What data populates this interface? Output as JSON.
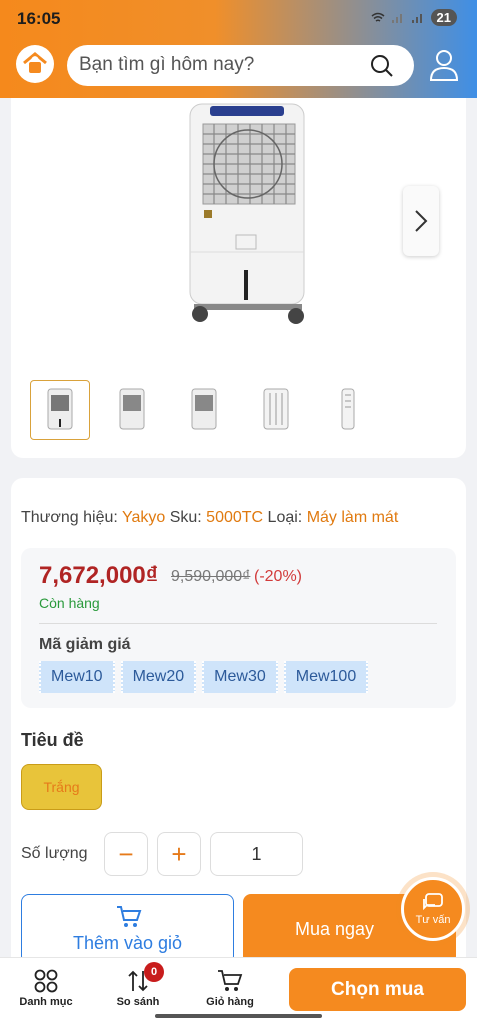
{
  "status": {
    "time": "16:05",
    "battery": "21"
  },
  "header": {
    "search_placeholder": "Bạn tìm gì hôm nay?",
    "icons": [
      "home-bag-logo",
      "search-icon",
      "user-icon"
    ]
  },
  "gallery": {
    "thumbnails": 5,
    "selected": 1,
    "next_icon": "chevron-right-icon"
  },
  "product": {
    "brand_label": "Thương hiệu:",
    "brand": "Yakyo",
    "sku_label": "Sku:",
    "sku": "5000TC",
    "type_label": "Loại:",
    "type": "Máy làm mát",
    "price": "7,672,000₫",
    "old_price": "9,590,000₫",
    "discount": "(-20%)",
    "stock": "Còn hàng"
  },
  "coupons": {
    "label": "Mã giảm giá",
    "codes": [
      "Mew10",
      "Mew20",
      "Mew30",
      "Mew100"
    ]
  },
  "variant": {
    "label": "Tiêu đề",
    "option": "Trắng"
  },
  "quantity": {
    "label": "Số lượng",
    "value": "1",
    "minus": "−",
    "plus": "+"
  },
  "actions": {
    "add_to_cart": "Thêm vào giỏ",
    "buy_now": "Mua ngay",
    "advise": "Tư vấn"
  },
  "bottom_nav": {
    "items": [
      "Danh mục",
      "So sánh",
      "Giỏ hàng"
    ],
    "compare_badge": "0",
    "choose": "Chọn mua"
  },
  "colors": {
    "accent": "#f58a1f",
    "brand_blue": "#2e7de0",
    "price_red": "#b02424",
    "stock_green": "#2a9a3c"
  }
}
